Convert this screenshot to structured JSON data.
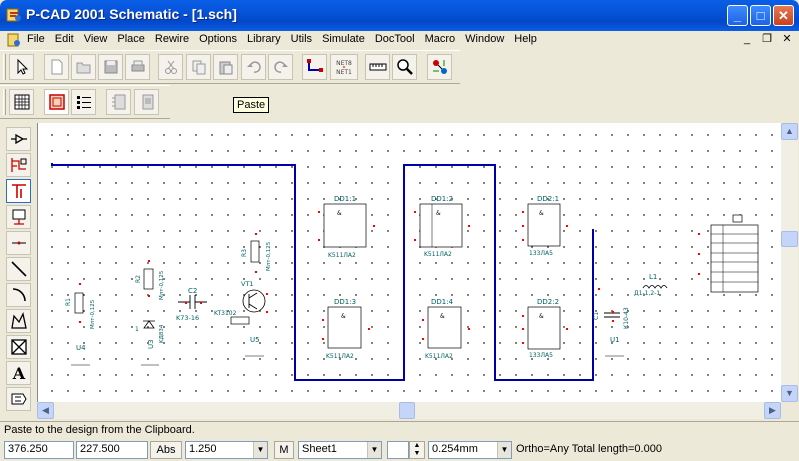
{
  "window": {
    "title": "P-CAD 2001 Schematic - [1.sch]",
    "minimize": "_",
    "maximize": "□",
    "close": "✕"
  },
  "menu": {
    "items": [
      "File",
      "Edit",
      "View",
      "Place",
      "Rewire",
      "Options",
      "Library",
      "Utils",
      "Simulate",
      "DocTool",
      "Macro",
      "Window",
      "Help"
    ],
    "mdi_minimize": "_",
    "mdi_restore": "❐",
    "mdi_close": "✕"
  },
  "toolbar1": {
    "icons": [
      "select-arrow-icon",
      "new-file-icon",
      "open-folder-icon",
      "save-icon",
      "print-icon",
      "cut-icon",
      "copy-icon",
      "paste-icon",
      "undo-icon",
      "redo-icon",
      "connection-icon",
      "netlist-icon",
      "ruler-icon",
      "zoom-icon",
      "plug-icon"
    ],
    "netlist_text_top": "NET8",
    "netlist_text_bottom": "NET1"
  },
  "toolbar2": {
    "icons": [
      "grid-icon",
      "board-icon",
      "list-icon",
      "component-icon",
      "component-alt-icon"
    ]
  },
  "tooltip": {
    "text": "Paste"
  },
  "palette": {
    "icons": [
      "place-part-icon",
      "place-pin-icon",
      "place-wire-icon",
      "place-port-icon",
      "place-bus-icon",
      "place-line-icon",
      "place-arc-icon",
      "place-polygon-icon",
      "place-field-icon",
      "place-text-icon",
      "place-attribute-icon"
    ],
    "text_tool_label": "A"
  },
  "schematic": {
    "wire_color": "#0000aa",
    "part_color": "#006060",
    "pin_color": "#ff0000",
    "labels": {
      "dd1_1": "DD1:1",
      "dd1_2": "DD1:2",
      "dd1_3": "DD1:3",
      "dd1_4": "DD1:4",
      "part_k511": "K511ЛА2",
      "part_133": "133ЛА5",
      "gate_sym": "&",
      "r1": "R1",
      "r2": "R2",
      "r3": "R3",
      "res_val": "Млт-0,125",
      "c1": "C1",
      "c2": "C2",
      "c2_val": "K73-16",
      "c1_val": "К10-43",
      "vt1": "VT1",
      "vt1_val": "KT3102",
      "vd": "KД834",
      "l1": "L1",
      "l1_val": "Д1-1,2-1",
      "u1": "U1",
      "u3": "U3",
      "u4": "U4",
      "u5": "U5",
      "dd2": "DD2:1",
      "dd2b": "DD2:2"
    }
  },
  "status": {
    "message": "Paste to the design from the Clipboard.",
    "x_coord": "376.250",
    "y_coord": "227.500",
    "abs_button": "Abs",
    "grid_value": "1.250",
    "m_button": "M",
    "sheet": "Sheet1",
    "line_width": "0.254mm",
    "ortho_info": "Ortho=Any Total length=0.000"
  }
}
